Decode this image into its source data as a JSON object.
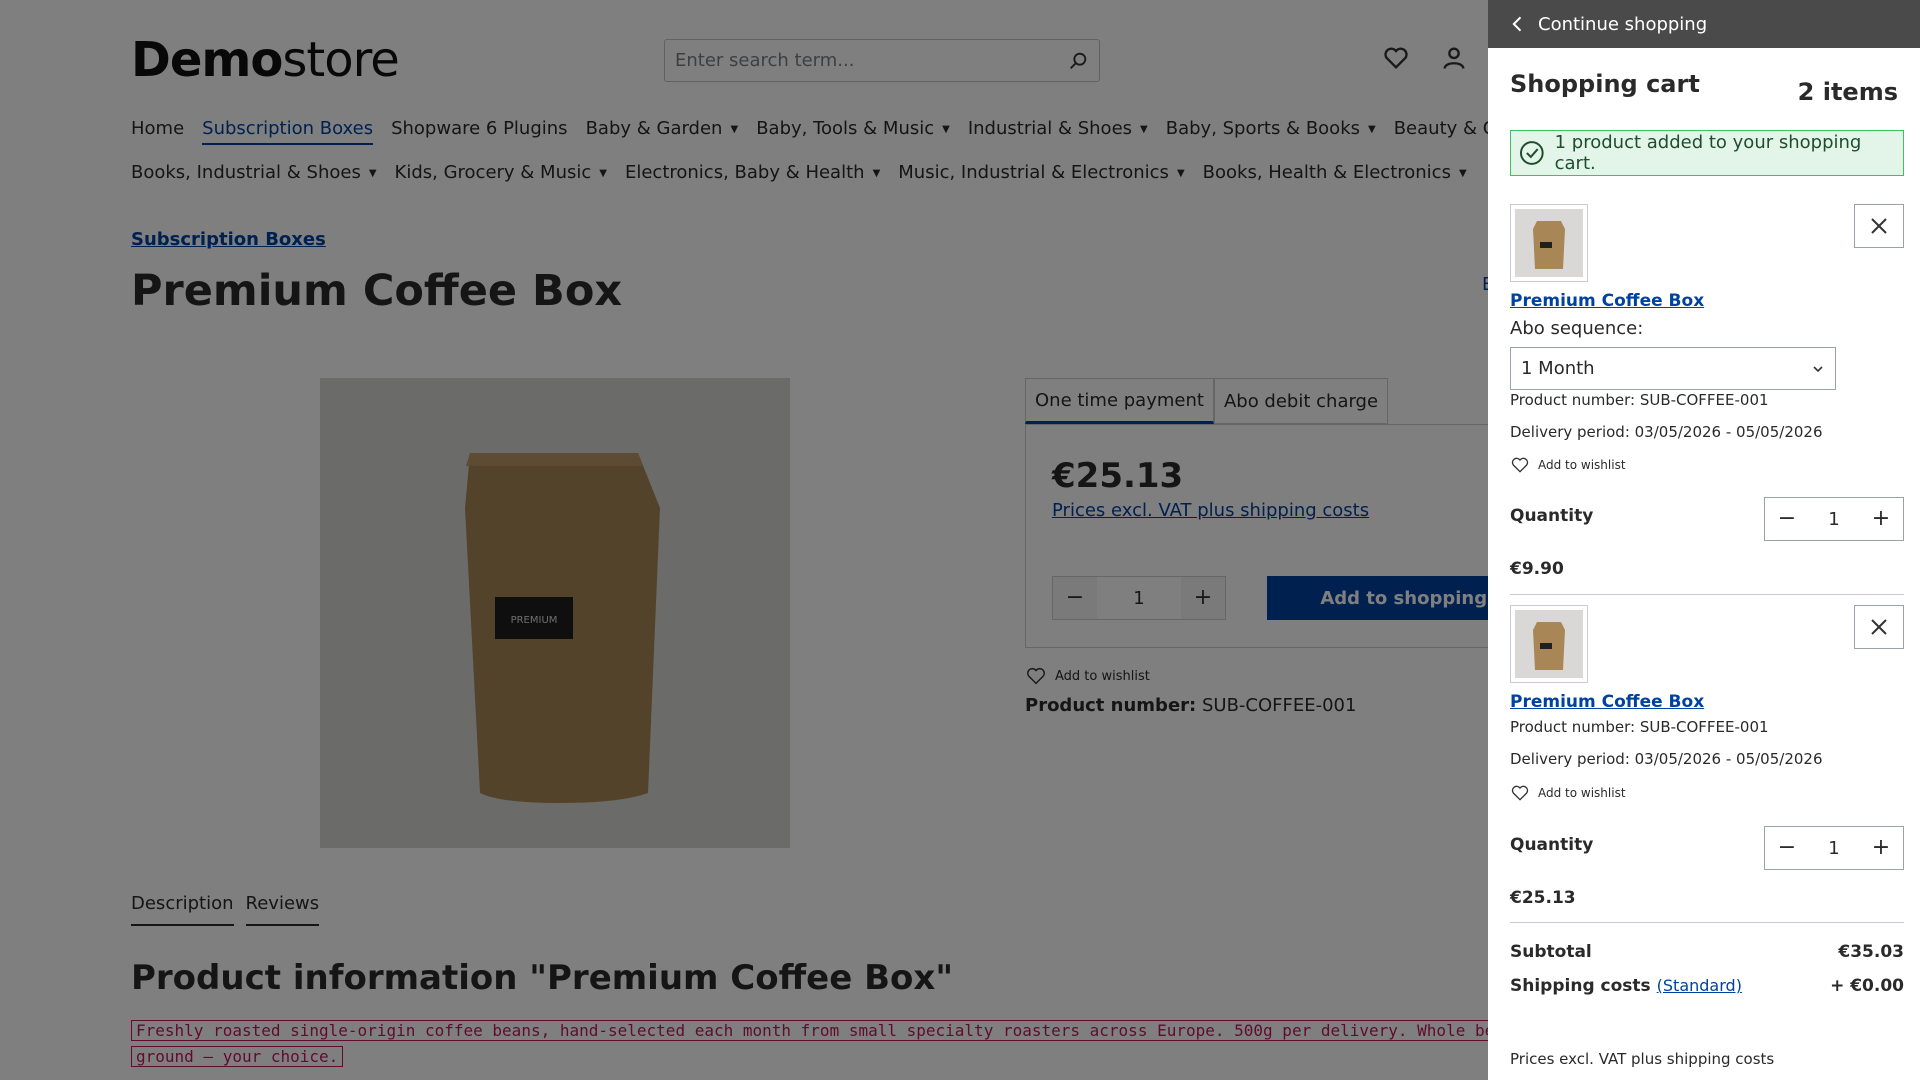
{
  "header": {
    "logo_bold": "Demo",
    "logo_light": "store",
    "search_placeholder": "Enter search term..."
  },
  "nav": {
    "row1": [
      "Home",
      "Subscription Boxes",
      "Shopware 6 Plugins",
      "Baby & Garden",
      "Baby, Tools & Music",
      "Industrial & Shoes",
      "Baby, Sports & Books",
      "Beauty & Computers"
    ],
    "row2": [
      "Books, Industrial & Shoes",
      "Kids, Grocery & Music",
      "Electronics, Baby & Health",
      "Music, Industrial & Electronics",
      "Books, Health & Electronics"
    ]
  },
  "product": {
    "breadcrumb": "Subscription Boxes",
    "title": "Premium Coffee Box",
    "partial_link": "E",
    "bag_label": "PREMIUM",
    "tab_one_time": "One time payment",
    "tab_abo": "Abo debit charge",
    "price": "€25.13",
    "price_note": "Prices excl. VAT plus shipping costs",
    "qty": "1",
    "add_to_cart": "Add to shopping cart",
    "wishlist": "Add to wishlist",
    "product_number_label": "Product number:",
    "product_number": "SUB-COFFEE-001"
  },
  "description": {
    "tab_description": "Description",
    "tab_reviews": "Reviews",
    "title": "Product information \"Premium Coffee Box\"",
    "line1": "Freshly roasted single-origin coffee beans, hand-selected each month from small specialty roasters across Europe. 500g per delivery. Whole beans or",
    "line2": "ground — your choice."
  },
  "cart": {
    "continue": "Continue shopping",
    "heading": "Shopping cart",
    "count": "2 items",
    "alert": "1 product added to your shopping cart.",
    "items": [
      {
        "name": "Premium Coffee Box",
        "abo_label": "Abo sequence:",
        "abo_value": "1 Month",
        "product_number": "Product number: SUB-COFFEE-001",
        "delivery": "Delivery period: 03/05/2026 - 05/05/2026",
        "wishlist": "Add to wishlist",
        "qty_label": "Quantity",
        "qty": "1",
        "price": "€9.90"
      },
      {
        "name": "Premium Coffee Box",
        "product_number": "Product number: SUB-COFFEE-001",
        "delivery": "Delivery period: 03/05/2026 - 05/05/2026",
        "wishlist": "Add to wishlist",
        "qty_label": "Quantity",
        "qty": "1",
        "price": "€25.13"
      }
    ],
    "subtotal_label": "Subtotal",
    "subtotal": "€35.03",
    "shipping_label": "Shipping costs",
    "shipping_method": "(Standard)",
    "shipping": "+ €0.00",
    "footer_note": "Prices excl. VAT plus shipping costs"
  },
  "colors": {
    "brand": "#0042a0",
    "success": "#3cc261",
    "overlay": "rgba(0,0,0,0.5)"
  }
}
